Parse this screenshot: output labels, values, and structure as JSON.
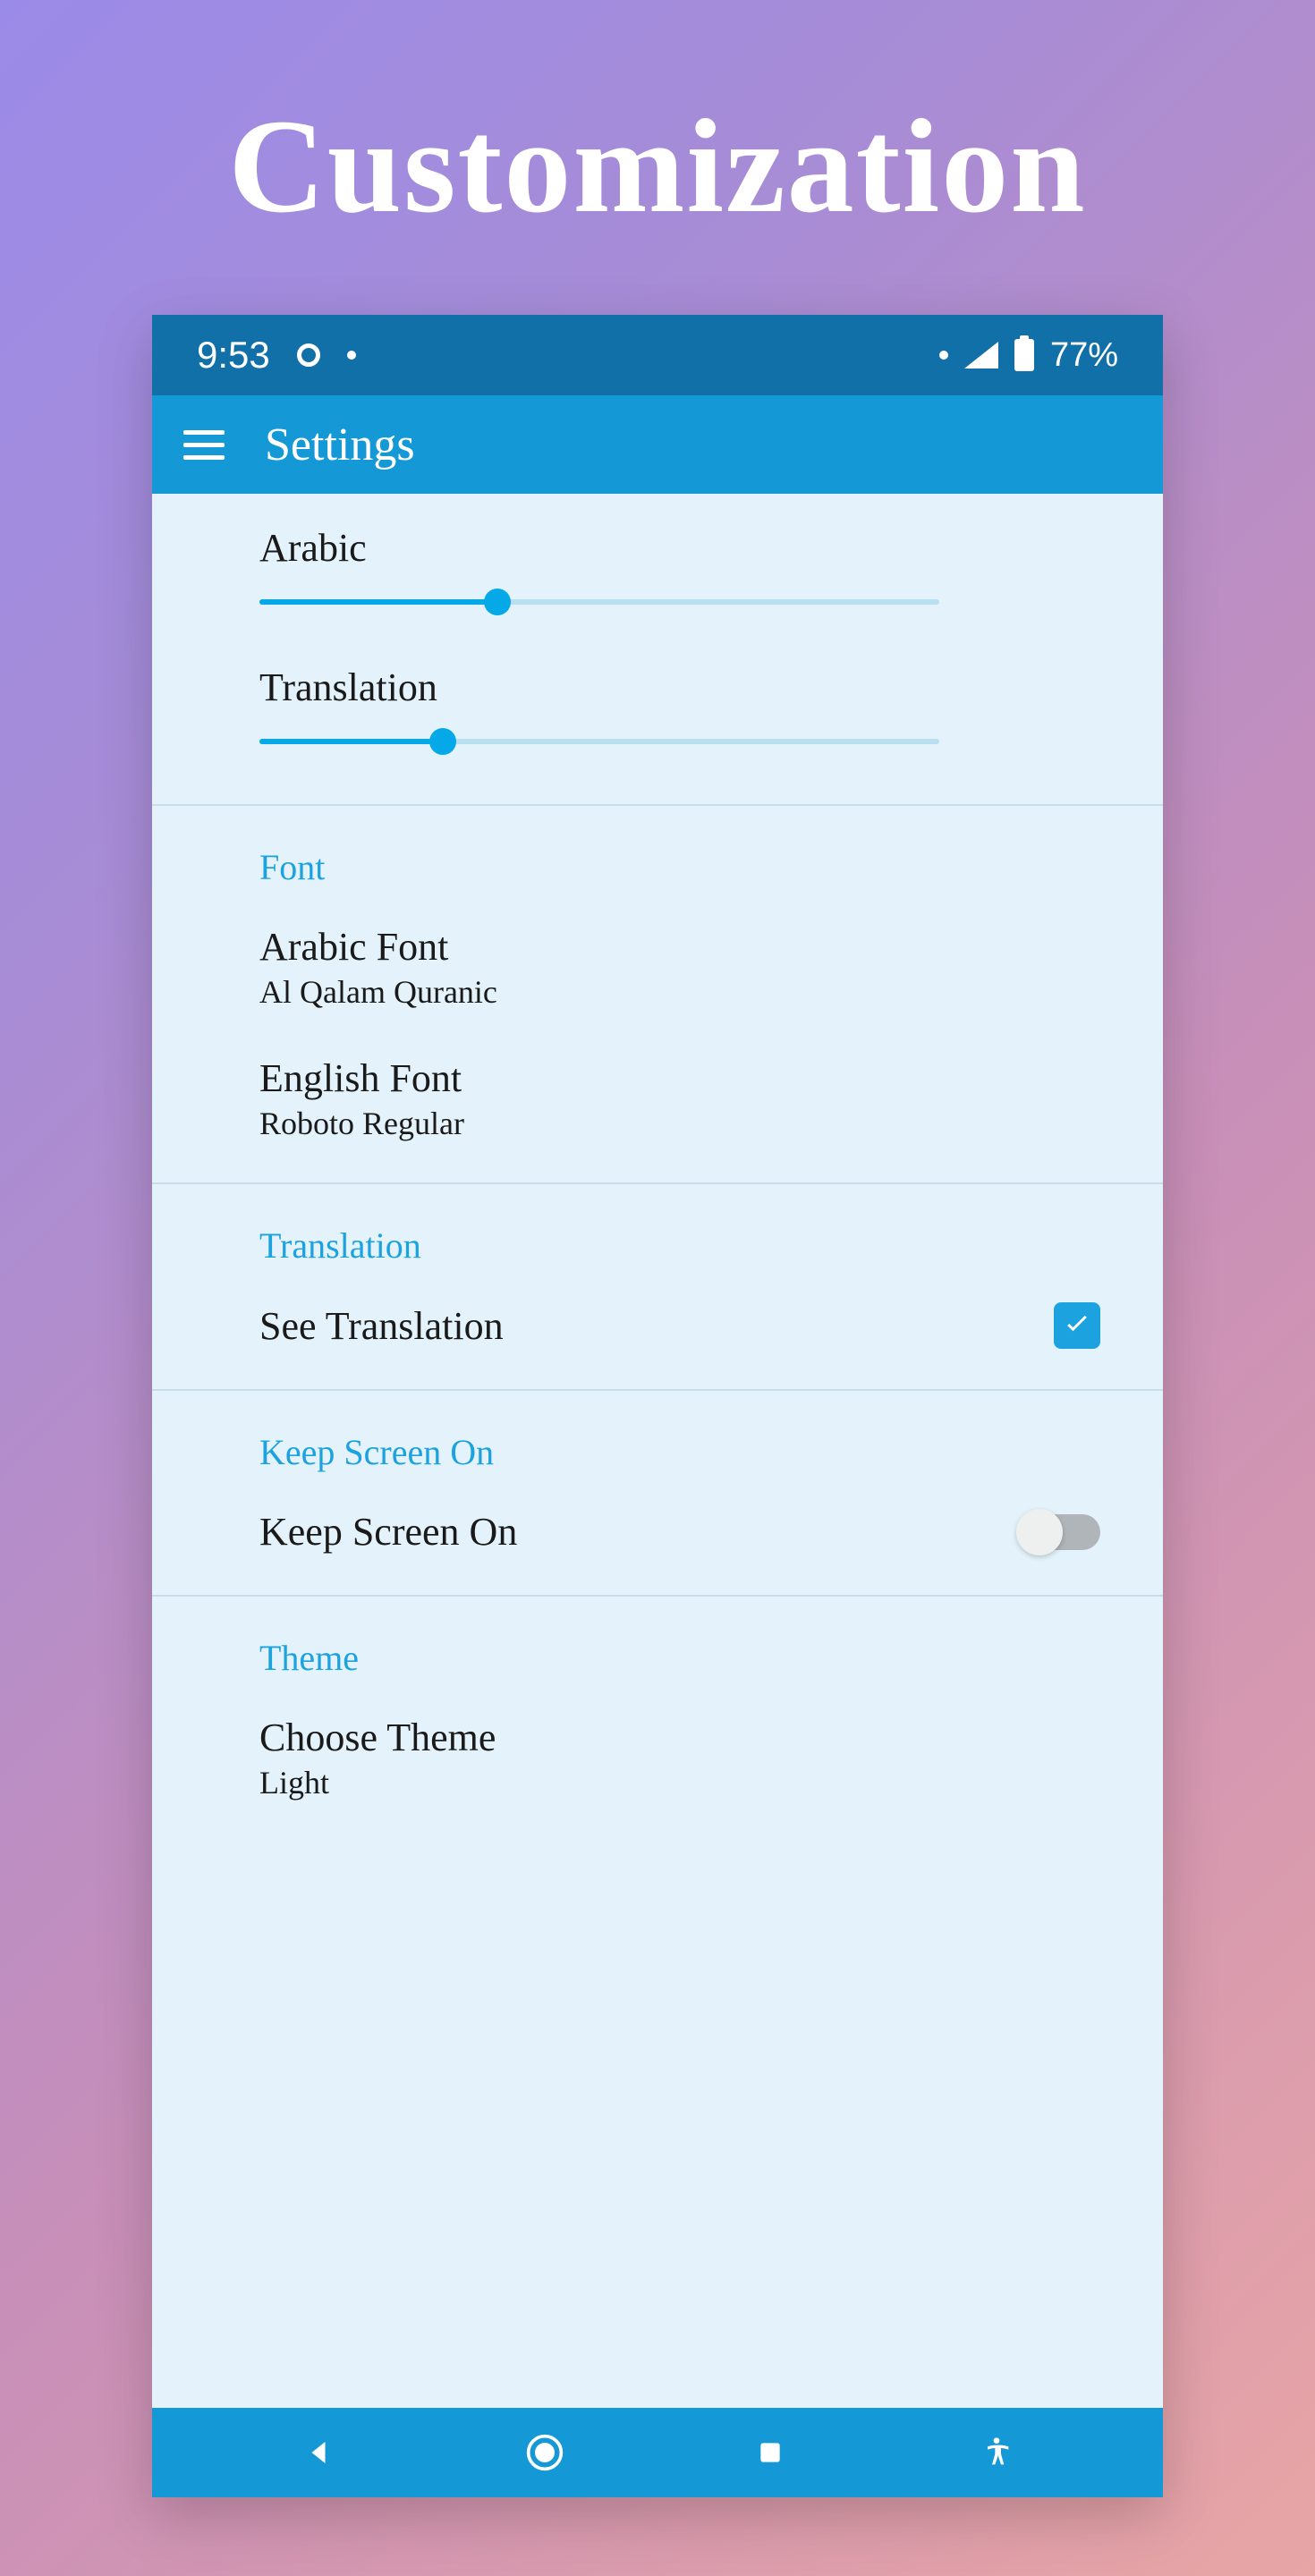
{
  "pageTitle": "Customization",
  "statusBar": {
    "time": "9:53",
    "battery": "77%"
  },
  "appBar": {
    "title": "Settings"
  },
  "sliders": {
    "arabic": {
      "label": "Arabic",
      "value": 35
    },
    "translation": {
      "label": "Translation",
      "value": 27
    }
  },
  "sections": {
    "font": {
      "header": "Font",
      "arabicFont": {
        "title": "Arabic Font",
        "value": "Al Qalam Quranic"
      },
      "englishFont": {
        "title": "English Font",
        "value": "Roboto Regular"
      }
    },
    "translation": {
      "header": "Translation",
      "seeTranslation": {
        "title": "See Translation",
        "checked": true
      }
    },
    "keepScreenOn": {
      "header": "Keep Screen On",
      "item": {
        "title": "Keep Screen On",
        "enabled": false
      }
    },
    "theme": {
      "header": "Theme",
      "chooseTheme": {
        "title": "Choose Theme",
        "value": "Light"
      }
    }
  }
}
